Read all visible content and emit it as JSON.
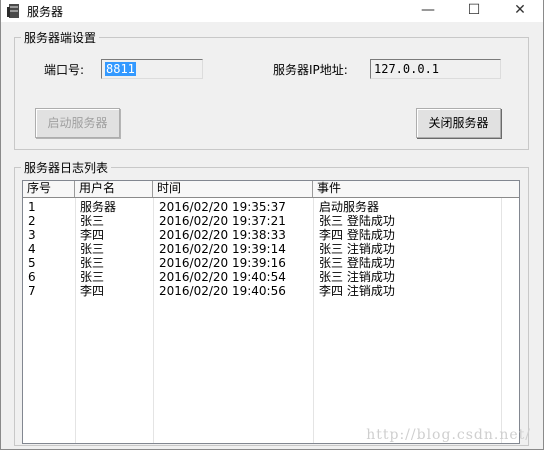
{
  "window": {
    "title": "服务器",
    "icon": "server-icon",
    "controls": {
      "minimize": "—",
      "maximize": "☐",
      "close": "✕"
    }
  },
  "settings": {
    "group_title": "服务器端设置",
    "port_label": "端口号:",
    "port_value": "8811",
    "ip_label": "服务器IP地址:",
    "ip_value": "127.0.0.1",
    "start_button": "启动服务器",
    "stop_button": "关闭服务器"
  },
  "log": {
    "group_title": "服务器日志列表",
    "columns": [
      "序号",
      "用户名",
      "时间",
      "事件"
    ],
    "rows": [
      [
        "1",
        "服务器",
        "2016/02/20 19:35:37",
        "启动服务器"
      ],
      [
        "2",
        "张三",
        "2016/02/20 19:37:21",
        "张三 登陆成功"
      ],
      [
        "3",
        "李四",
        "2016/02/20 19:38:33",
        "李四 登陆成功"
      ],
      [
        "4",
        "张三",
        "2016/02/20 19:39:14",
        "张三 注销成功"
      ],
      [
        "5",
        "张三",
        "2016/02/20 19:39:16",
        "张三 登陆成功"
      ],
      [
        "6",
        "张三",
        "2016/02/20 19:40:54",
        "张三 注销成功"
      ],
      [
        "7",
        "李四",
        "2016/02/20 19:40:56",
        "李四 注销成功"
      ]
    ]
  },
  "watermark": "http://blog.csdn.net/"
}
